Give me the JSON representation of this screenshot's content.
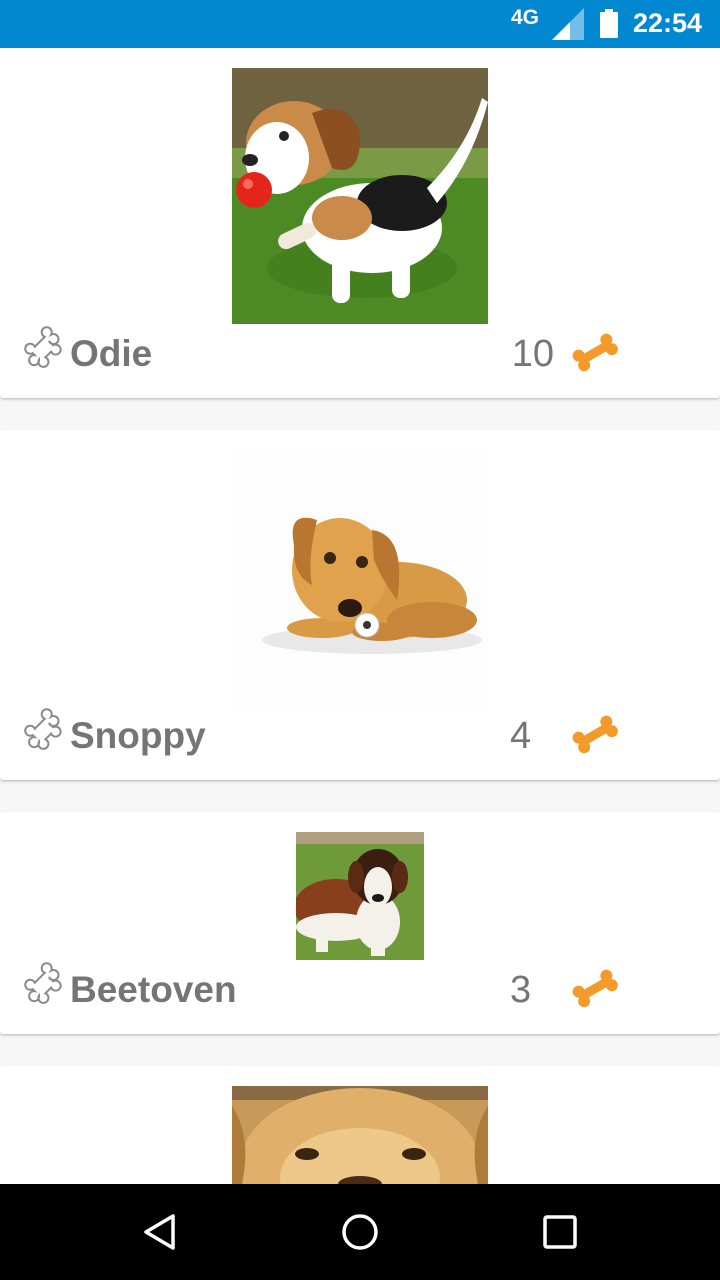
{
  "status_bar": {
    "network": "4G",
    "time": "22:54",
    "color": "#0288d1"
  },
  "dogs": [
    {
      "name": "Odie",
      "bones": "10",
      "photo_icon": "beagle-puppy-photo"
    },
    {
      "name": "Snoppy",
      "bones": "4",
      "photo_icon": "golden-puppy-photo"
    },
    {
      "name": "Beetoven",
      "bones": "3",
      "photo_icon": "st-bernard-photo"
    },
    {
      "name": "",
      "bones": "",
      "photo_icon": "golden-retriever-photo"
    }
  ],
  "colors": {
    "name_text": "#757575",
    "bone_accent": "#f39a2a"
  },
  "icons": {
    "rating": "bone-outline-icon",
    "bones": "bone-icon",
    "nav_back": "back-triangle-icon",
    "nav_home": "home-circle-icon",
    "nav_recents": "recents-square-icon"
  }
}
